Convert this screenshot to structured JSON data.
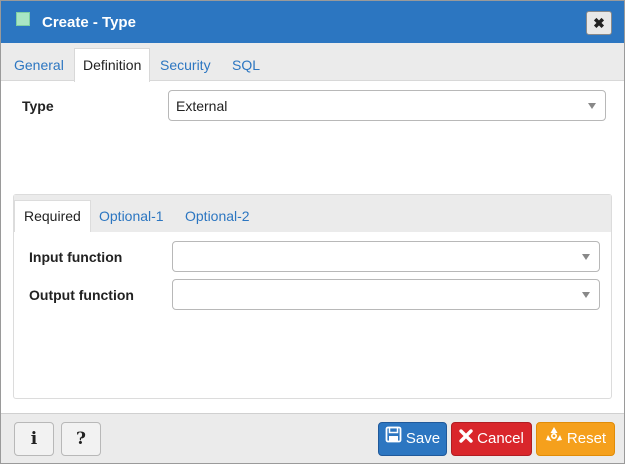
{
  "window": {
    "title": "Create - Type",
    "close_glyph": "✖",
    "icon": "type-node-icon"
  },
  "tabs": [
    {
      "label": "General",
      "active": false
    },
    {
      "label": "Definition",
      "active": true
    },
    {
      "label": "Security",
      "active": false
    },
    {
      "label": "SQL",
      "active": false
    }
  ],
  "definition": {
    "type_label": "Type",
    "type_value": "External"
  },
  "subtabs": [
    {
      "label": "Required",
      "active": true
    },
    {
      "label": "Optional-1",
      "active": false
    },
    {
      "label": "Optional-2",
      "active": false
    }
  ],
  "required": {
    "input_function_label": "Input function",
    "input_function_value": "",
    "output_function_label": "Output function",
    "output_function_value": ""
  },
  "footer": {
    "info_label": "i",
    "help_label": "?",
    "save_label": "Save",
    "cancel_label": "Cancel",
    "reset_label": "Reset"
  },
  "colors": {
    "titlebar": "#2c76c1",
    "link": "#2c76c1",
    "save": "#2c76c1",
    "cancel": "#d9262b",
    "reset": "#f5a01c"
  }
}
